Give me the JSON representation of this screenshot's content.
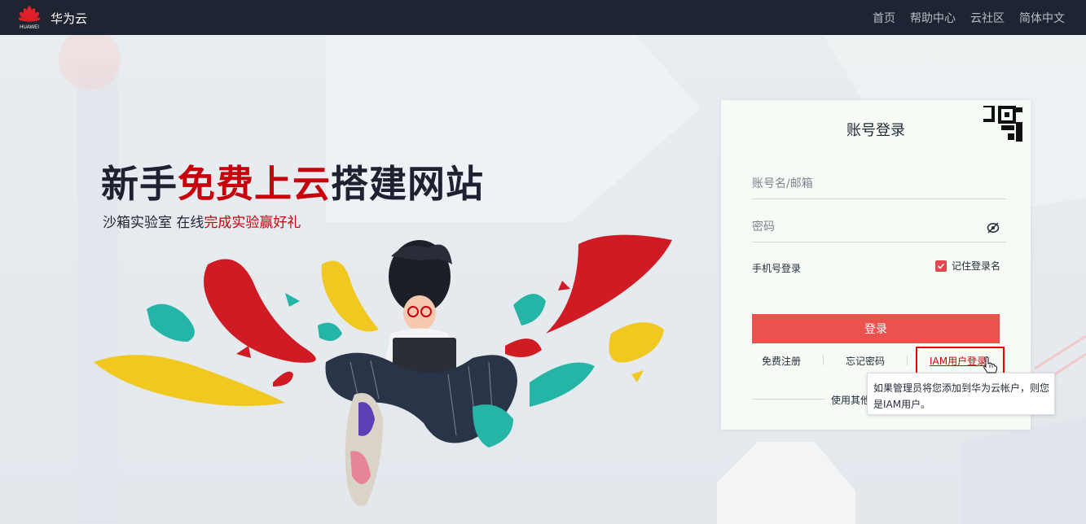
{
  "topbar": {
    "logo_text": "HUAWEI",
    "brand": "华为云",
    "nav": [
      "首页",
      "帮助中心",
      "云社区",
      "简体中文"
    ]
  },
  "hero": {
    "title_part1": "新手",
    "title_red": "免费上云",
    "title_part2": "搭建网站",
    "sub_part1": "沙箱实验室 在线",
    "sub_red": "完成实验赢好礼"
  },
  "login": {
    "title": "账号登录",
    "username_placeholder": "账号名/邮箱",
    "password_placeholder": "密码",
    "phone_login": "手机号登录",
    "remember_label": "记住登录名",
    "remember_checked": true,
    "login_button": "登录",
    "register_link": "免费注册",
    "forgot_link": "忘记密码",
    "iam_link": "IAM用户登录",
    "other_login": "使用其他"
  },
  "tooltip": {
    "line1": "如果管理员将您添加到华为云帐户，则您",
    "line2": "是IAM用户。"
  },
  "colors": {
    "brand_red": "#c7000b",
    "button_red": "#e9524d",
    "topbar": "#1e2431"
  }
}
